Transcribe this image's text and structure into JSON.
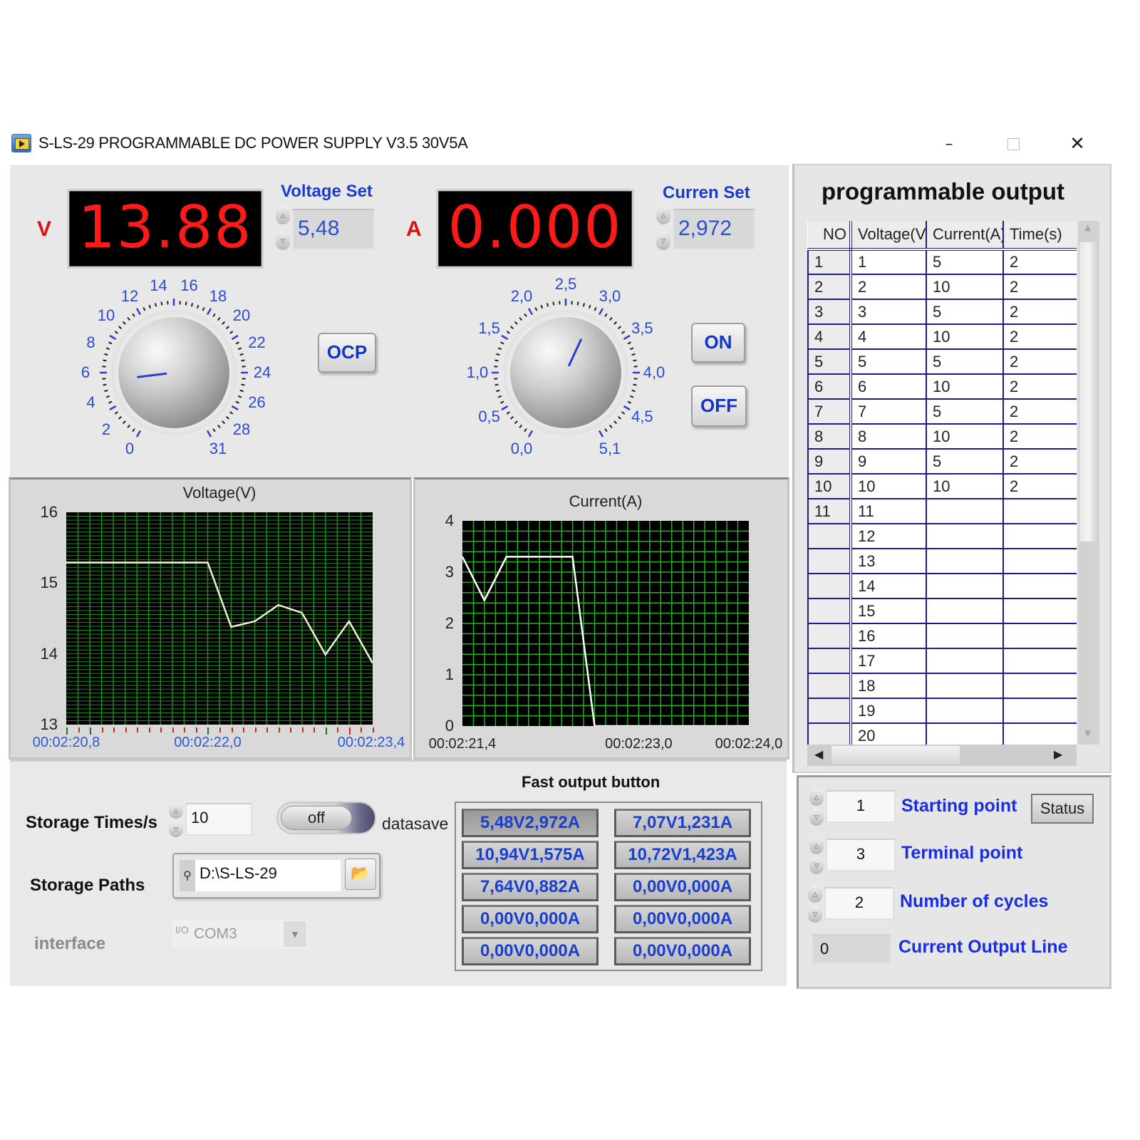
{
  "window": {
    "title": "S-LS-29 PROGRAMMABLE DC POWER SUPPLY V3.5  30V5A",
    "minimize_icon": "–",
    "close_icon": "✕"
  },
  "voltage": {
    "unit": "V",
    "display": "13.88",
    "set_label": "Voltage Set",
    "set_value": "5,48",
    "dial_labels": [
      "0",
      "2",
      "4",
      "6",
      "8",
      "10",
      "12",
      "14",
      "16",
      "18",
      "20",
      "22",
      "24",
      "26",
      "28",
      "31"
    ],
    "dial_value": 5.48,
    "dial_max": 31
  },
  "current": {
    "unit": "A",
    "display": "0.000",
    "set_label": "Curren Set",
    "set_value": "2,972",
    "dial_labels": [
      "0,0",
      "0,5",
      "1,0",
      "1,5",
      "2,0",
      "2,5",
      "3,0",
      "3,5",
      "4,0",
      "4,5",
      "5,1"
    ],
    "dial_value": 2.972,
    "dial_max": 5.1
  },
  "buttons": {
    "ocp": "OCP",
    "on": "ON",
    "off": "OFF",
    "status": "Status"
  },
  "chart_data": [
    {
      "type": "line",
      "title": "Voltage(V)",
      "xlabel": "",
      "ylabel": "",
      "ylim": [
        13,
        16
      ],
      "yticks": [
        "13",
        "14",
        "15",
        "16"
      ],
      "xlim": [
        20.8,
        23.4
      ],
      "xtick_labels": [
        "00:02:20,8",
        "00:02:22,0",
        "00:02:23,4"
      ],
      "xtick_values": [
        20.8,
        22.0,
        23.4
      ],
      "grid": true,
      "x": [
        20.8,
        22.0,
        22.2,
        22.4,
        22.6,
        22.8,
        23.0,
        23.2,
        23.4
      ],
      "values": [
        15.29,
        15.29,
        14.38,
        14.46,
        14.69,
        14.58,
        13.99,
        14.46,
        13.87
      ],
      "line_color": "#f0f0d0",
      "plot_bg": "#000000",
      "grid_color": "#1f8a1f"
    },
    {
      "type": "line",
      "title": "Current(A)",
      "xlabel": "",
      "ylabel": "",
      "ylim": [
        0,
        4
      ],
      "yticks": [
        "0",
        "1",
        "2",
        "3",
        "4"
      ],
      "xlim": [
        21.4,
        24.0
      ],
      "xtick_labels": [
        "00:02:21,4",
        "00:02:23,0",
        "00:02:24,0"
      ],
      "xtick_values": [
        21.4,
        23.0,
        24.0
      ],
      "grid": true,
      "x": [
        21.4,
        21.6,
        21.8,
        22.4,
        22.6,
        24.0
      ],
      "values": [
        3.3,
        2.45,
        3.3,
        3.3,
        0,
        0
      ],
      "line_color": "#ffffff",
      "plot_bg": "#000000",
      "grid_color": "#22b022"
    }
  ],
  "program": {
    "title": "programmable output",
    "columns": [
      "NO",
      "Voltage(V)",
      "Current(A)",
      "Time(s)"
    ],
    "rows": [
      [
        "1",
        "1",
        "5",
        "2"
      ],
      [
        "2",
        "2",
        "10",
        "2"
      ],
      [
        "3",
        "3",
        "5",
        "2"
      ],
      [
        "4",
        "4",
        "10",
        "2"
      ],
      [
        "5",
        "5",
        "5",
        "2"
      ],
      [
        "6",
        "6",
        "10",
        "2"
      ],
      [
        "7",
        "7",
        "5",
        "2"
      ],
      [
        "8",
        "8",
        "10",
        "2"
      ],
      [
        "9",
        "9",
        "5",
        "2"
      ],
      [
        "10",
        "10",
        "10",
        "2"
      ],
      [
        "11",
        "11",
        "",
        ""
      ],
      [
        "",
        "12",
        "",
        ""
      ],
      [
        "",
        "13",
        "",
        ""
      ],
      [
        "",
        "14",
        "",
        ""
      ],
      [
        "",
        "15",
        "",
        ""
      ],
      [
        "",
        "16",
        "",
        ""
      ],
      [
        "",
        "17",
        "",
        ""
      ],
      [
        "",
        "18",
        "",
        ""
      ],
      [
        "",
        "19",
        "",
        ""
      ],
      [
        "",
        "20",
        "",
        ""
      ]
    ]
  },
  "storage": {
    "times_label": "Storage Times/s",
    "times_value": "10",
    "toggle_state": "off",
    "toggle_label": "datasave",
    "paths_label": "Storage  Paths",
    "path_value": "D:\\S-LS-29",
    "interface_label": "interface",
    "interface_value": "COM3"
  },
  "fast_output": {
    "title": "Fast output button",
    "buttons": [
      "5,48V2,972A",
      "7,07V1,231A",
      "10,94V1,575A",
      "10,72V1,423A",
      "7,64V0,882A",
      "0,00V0,000A",
      "0,00V0,000A",
      "0,00V0,000A",
      "0,00V0,000A",
      "0,00V0,000A"
    ]
  },
  "sequence": {
    "starting_point_label": "Starting point",
    "starting_point_value": "1",
    "terminal_point_label": "Terminal point",
    "terminal_point_value": "3",
    "cycles_label": "Number of cycles",
    "cycles_value": "2",
    "current_line_label": "Current Output Line",
    "current_line_value": "0"
  }
}
